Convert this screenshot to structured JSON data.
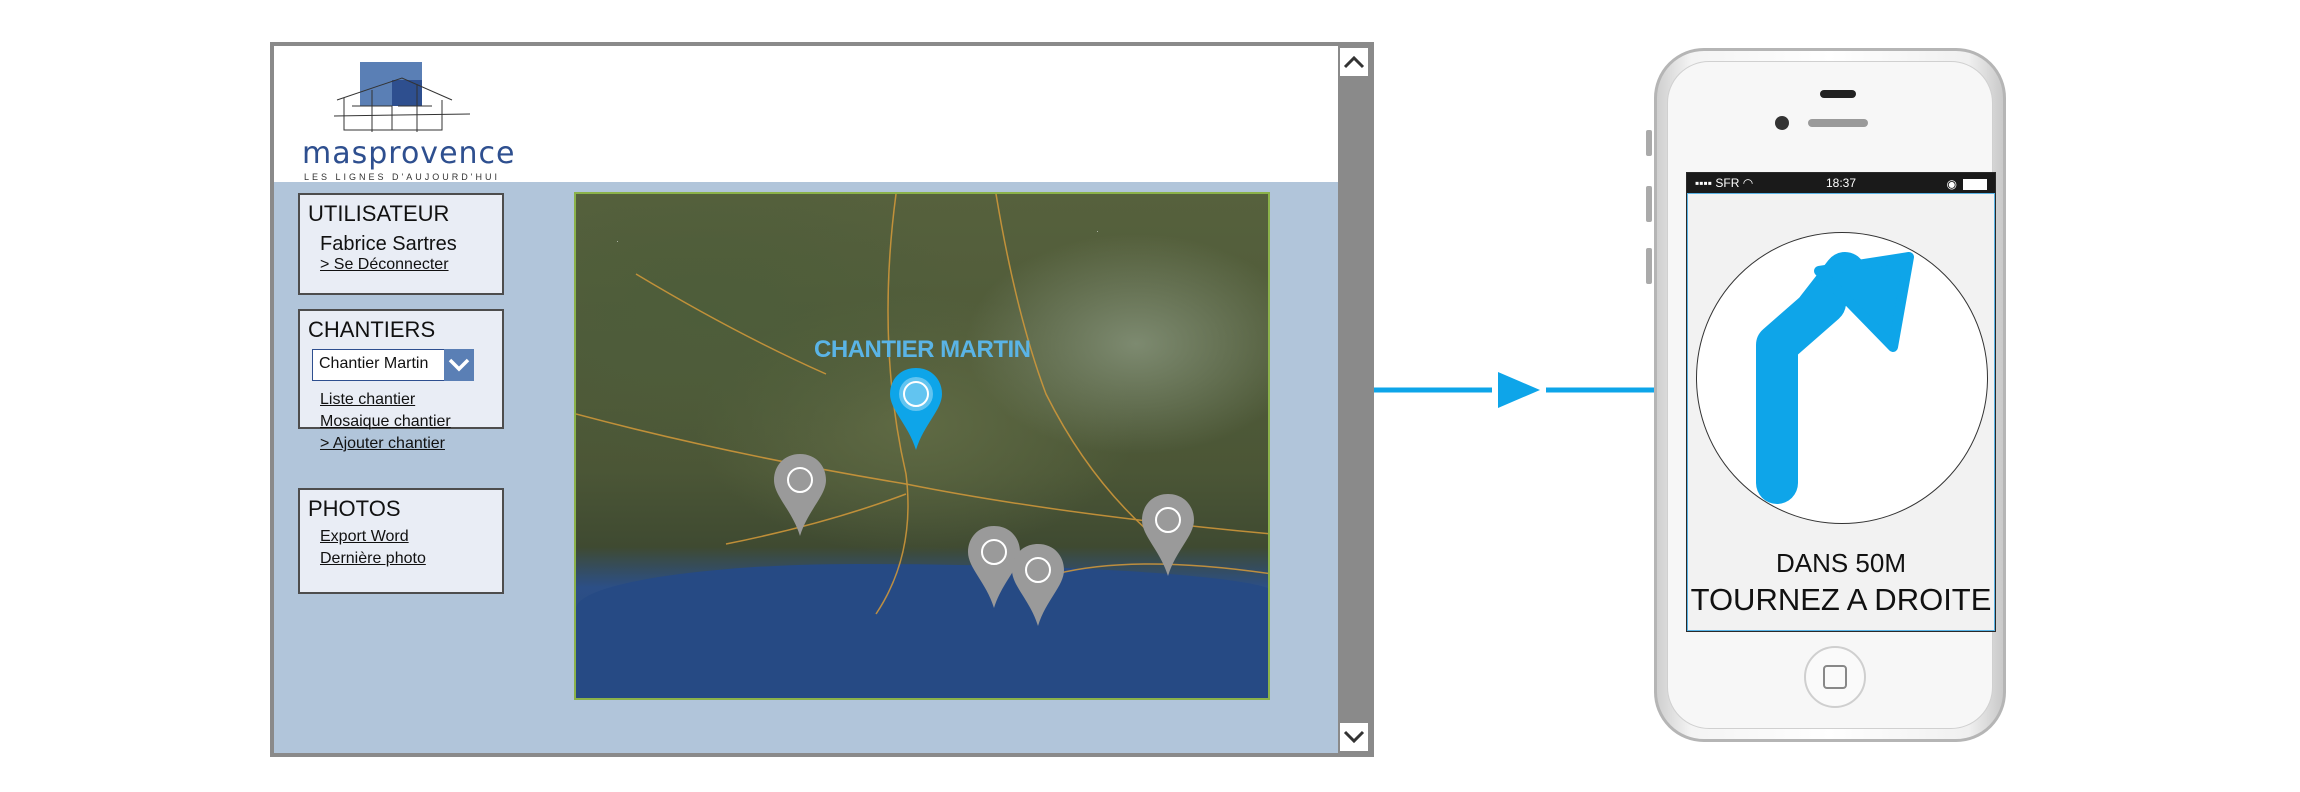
{
  "logo": {
    "word": "masprovence",
    "tagline": "LES LIGNES D'AUJOURD'HUI"
  },
  "panels": {
    "user": {
      "title": "UTILISATEUR",
      "name": "Fabrice Sartres",
      "logout": "> Se Déconnecter"
    },
    "chantiers": {
      "title": "CHANTIERS",
      "selected": "Chantier Martin",
      "links": [
        "Liste chantier",
        "Mosaique chantier",
        "> Ajouter chantier"
      ]
    },
    "photos": {
      "title": "PHOTOS",
      "links": [
        "Export Word",
        "Dernière photo"
      ]
    }
  },
  "map": {
    "label": "CHANTIER MARTIN"
  },
  "phone": {
    "carrier": "SFR",
    "time": "18:37",
    "distance": "DANS 50M",
    "instruction": "TOURNEZ A DROITE"
  },
  "colors": {
    "accent": "#0ea5e9",
    "panel_bg": "#e9edf5",
    "window_bg": "#b1c5da",
    "logo_blue": "#2e4f8f"
  }
}
